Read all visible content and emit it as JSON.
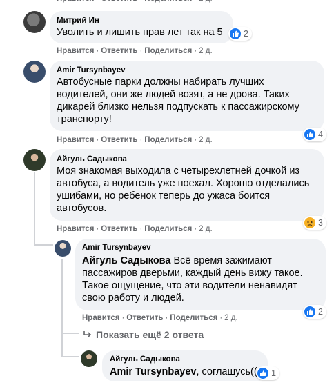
{
  "actions": {
    "like": "Нравится",
    "reply": "Ответить",
    "share": "Поделиться",
    "sep": "·"
  },
  "comments": [
    {
      "author": "Митрий Ин",
      "text": "Уволить и лишить прав лет так на 5",
      "time": "2 д.",
      "reaction": {
        "type": "like-icon",
        "count": "2"
      }
    },
    {
      "author": "Amir Tursynbayev",
      "lines": [
        "Автобусные парки должны набирать лучших",
        "водителей, они же людей возят, а не дрова. Таких",
        "дикарей близко нельзя подпускать к пассажирскому",
        "транспорту!"
      ],
      "time": "2 д.",
      "reaction": {
        "type": "like-icon",
        "count": "4"
      }
    },
    {
      "author": "Айгуль Садыкова",
      "lines": [
        "Моя знакомая выходила с четырехлетней дочкой из",
        "автобуса, а водитель уже поехал. Хорошо отделались",
        "ушибами, но ребенок теперь до ужаса боится",
        "автобусов."
      ],
      "time": "2 д.",
      "reaction": {
        "type": "sad-icon",
        "count": "3"
      }
    }
  ],
  "replies": [
    {
      "author": "Amir Tursynbayev",
      "mention": "Айгуль Садыкова",
      "first_line_rest": " Всё время зажимают",
      "lines": [
        "пассажиров дверьми, каждый день вижу такое.",
        "Такое ощущение, что эти водители ненавидят",
        "свою работу и людей."
      ],
      "time": "2 д.",
      "reaction": {
        "type": "like-icon",
        "count": "2"
      }
    },
    {
      "author": "Айгуль Садыкова",
      "mention": "Amir Tursynbayev",
      "rest": ", соглашусь((",
      "reaction": {
        "type": "like-icon",
        "count": "1"
      }
    }
  ],
  "show_more": "Показать ещё 2 ответа",
  "colors": {
    "bubble": "#f0f2f5",
    "meta": "#65676b",
    "like": "#1877f2",
    "sad": "#f7b125"
  }
}
